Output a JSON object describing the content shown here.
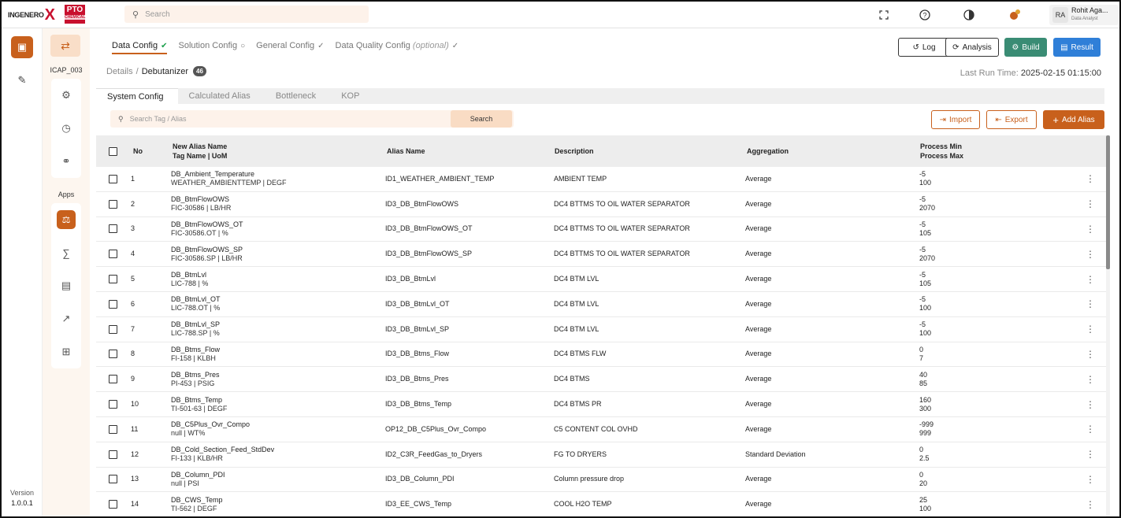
{
  "topbar": {
    "logo_text": "INGENERO",
    "logo_x": "X",
    "partner_logo_text": "PTO",
    "partner_logo_sub": "CHEMICAL",
    "search_placeholder": "Search",
    "user_initials": "RA",
    "user_name": "Rohit Aga...",
    "user_role": "Data Analyst"
  },
  "rail": {
    "version_label": "Version",
    "version_value": "1.0.0.1"
  },
  "rail2": {
    "project": "ICAP_003",
    "apps_label": "Apps"
  },
  "steps": [
    {
      "label": "Data Config"
    },
    {
      "label": "Solution Config"
    },
    {
      "label": "General Config"
    },
    {
      "label": "Data Quality Config",
      "note": "(optional)"
    }
  ],
  "breadcrumb": {
    "parent": "Details",
    "current": "Debutanizer",
    "count": "46"
  },
  "buttons": {
    "log": "Log",
    "analysis": "Analysis",
    "build": "Build",
    "result": "Result"
  },
  "last_run": {
    "label": "Last Run Time:",
    "value": "2025-02-15 01:15:00"
  },
  "tabs": [
    "System Config",
    "Calculated Alias",
    "Bottleneck",
    "KOP"
  ],
  "alias_search": {
    "placeholder": "Search Tag / Alias",
    "button": "Search"
  },
  "actions": {
    "import": "Import",
    "export": "Export",
    "add": "Add Alias"
  },
  "table": {
    "headers": {
      "no": "No",
      "new_alias_1": "New Alias Name",
      "new_alias_2": "Tag Name | UoM",
      "alias": "Alias Name",
      "desc": "Description",
      "agg": "Aggregation",
      "min": "Process Min",
      "max": "Process Max"
    },
    "rows": [
      {
        "no": "1",
        "new_alias": "DB_Ambient_Temperature",
        "tag": "WEATHER_AMBIENTTEMP | DEGF",
        "alias": "ID1_WEATHER_AMBIENT_TEMP",
        "desc": "AMBIENT TEMP",
        "agg": "Average",
        "min": "-5",
        "max": "100"
      },
      {
        "no": "2",
        "new_alias": "DB_BtmFlowOWS",
        "tag": "FIC-30586 | LB/HR",
        "alias": "ID3_DB_BtmFlowOWS",
        "desc": "DC4 BTTMS TO OIL WATER SEPARATOR",
        "agg": "Average",
        "min": "-5",
        "max": "2070"
      },
      {
        "no": "3",
        "new_alias": "DB_BtmFlowOWS_OT",
        "tag": "FIC-30586.OT | %",
        "alias": "ID3_DB_BtmFlowOWS_OT",
        "desc": "DC4 BTTMS TO OIL WATER SEPARATOR",
        "agg": "Average",
        "min": "-5",
        "max": "105"
      },
      {
        "no": "4",
        "new_alias": "DB_BtmFlowOWS_SP",
        "tag": "FIC-30586.SP | LB/HR",
        "alias": "ID3_DB_BtmFlowOWS_SP",
        "desc": "DC4 BTTMS TO OIL WATER SEPARATOR",
        "agg": "Average",
        "min": "-5",
        "max": "2070"
      },
      {
        "no": "5",
        "new_alias": "DB_BtmLvl",
        "tag": "LIC-788 | %",
        "alias": "ID3_DB_BtmLvl",
        "desc": "DC4 BTM LVL",
        "agg": "Average",
        "min": "-5",
        "max": "105"
      },
      {
        "no": "6",
        "new_alias": "DB_BtmLvl_OT",
        "tag": "LIC-788.OT | %",
        "alias": "ID3_DB_BtmLvl_OT",
        "desc": "DC4 BTM LVL",
        "agg": "Average",
        "min": "-5",
        "max": "100"
      },
      {
        "no": "7",
        "new_alias": "DB_BtmLvl_SP",
        "tag": "LIC-788.SP | %",
        "alias": "ID3_DB_BtmLvl_SP",
        "desc": "DC4 BTM LVL",
        "agg": "Average",
        "min": "-5",
        "max": "100"
      },
      {
        "no": "8",
        "new_alias": "DB_Btms_Flow",
        "tag": "FI-158 | KLBH",
        "alias": "ID3_DB_Btms_Flow",
        "desc": "DC4 BTMS FLW",
        "agg": "Average",
        "min": "0",
        "max": "7"
      },
      {
        "no": "9",
        "new_alias": "DB_Btms_Pres",
        "tag": "PI-453 | PSIG",
        "alias": "ID3_DB_Btms_Pres",
        "desc": "DC4 BTMS",
        "agg": "Average",
        "min": "40",
        "max": "85"
      },
      {
        "no": "10",
        "new_alias": "DB_Btms_Temp",
        "tag": "TI-501-63 | DEGF",
        "alias": "ID3_DB_Btms_Temp",
        "desc": "DC4 BTMS PR",
        "agg": "Average",
        "min": "160",
        "max": "300"
      },
      {
        "no": "11",
        "new_alias": "DB_C5Plus_Ovr_Compo",
        "tag": "null | WT%",
        "alias": "OP12_DB_C5Plus_Ovr_Compo",
        "desc": "C5 CONTENT COL OVHD",
        "agg": "Average",
        "min": "-999",
        "max": "999"
      },
      {
        "no": "12",
        "new_alias": "DB_Cold_Section_Feed_StdDev",
        "tag": "FI-133 | KLB/HR",
        "alias": "ID2_C3R_FeedGas_to_Dryers",
        "desc": "FG TO DRYERS",
        "agg": "Standard Deviation",
        "min": "0",
        "max": "2.5"
      },
      {
        "no": "13",
        "new_alias": "DB_Column_PDI",
        "tag": "null | PSI",
        "alias": "ID3_DB_Column_PDI",
        "desc": "Column pressure drop",
        "agg": "Average",
        "min": "0",
        "max": "20"
      },
      {
        "no": "14",
        "new_alias": "DB_CWS_Temp",
        "tag": "TI-562 | DEGF",
        "alias": "ID3_EE_CWS_Temp",
        "desc": "COOL H2O TEMP",
        "agg": "Average",
        "min": "25",
        "max": "100"
      }
    ]
  }
}
